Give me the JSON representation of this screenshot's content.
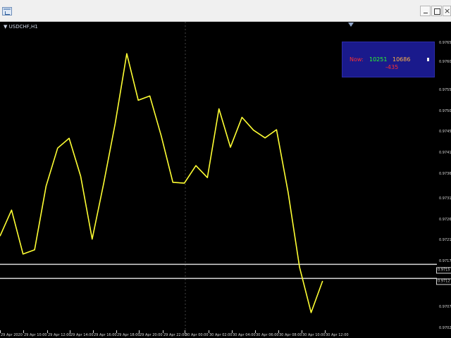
{
  "window": {
    "symbol_label": "USDCHF,H1"
  },
  "panel": {
    "now_label": "Now:",
    "value_1": "10251",
    "value_2": "10686",
    "difference": "-435",
    "colors": {
      "background": "#1a1a8c",
      "now": "#ff3030",
      "value_1": "#2cff2c",
      "value_2": "#ffb347",
      "difference": "#ff3030"
    }
  },
  "price_axis": {
    "labels": [
      "0.9765",
      "0.9760",
      "0.9755",
      "0.9750",
      "0.9745",
      "0.9741",
      "0.9736",
      "0.9731",
      "0.9726",
      "0.9721",
      "0.9717",
      "0.9715",
      "0.9712",
      "0.9707",
      "0.9702"
    ],
    "boxed": [
      "0.9715",
      "0.9712"
    ]
  },
  "time_axis": {
    "labels": [
      "29 Apr 2020",
      "29 Apr 10:00",
      "29 Apr 12:00",
      "29 Apr 14:00",
      "29 Apr 16:00",
      "29 Apr 18:00",
      "29 Apr 20:00",
      "29 Apr 22:00",
      "30 Apr 00:00",
      "30 Apr 02:00",
      "30 Apr 04:00",
      "30 Apr 06:00",
      "30 Apr 08:00",
      "30 Apr 10:00",
      "30 Apr 12:00"
    ]
  },
  "chart_data": {
    "type": "line",
    "series": [
      {
        "values": [
          0.97219,
          0.9728,
          0.97177,
          0.97187,
          0.97336,
          0.97425,
          0.97448,
          0.97359,
          0.97212,
          0.97343,
          0.97483,
          0.97646,
          0.97537,
          0.97547,
          0.97453,
          0.97345,
          0.97343,
          0.97384,
          0.97356,
          0.97517,
          0.97427,
          0.97497,
          0.97467,
          0.97449,
          0.97468,
          0.97322,
          0.97146,
          0.9704,
          0.97114
        ]
      }
    ],
    "horizontal_lines": [
      0.97153,
      0.9712
    ],
    "colors": {
      "line": "#ffff33",
      "background": "#000000"
    }
  }
}
